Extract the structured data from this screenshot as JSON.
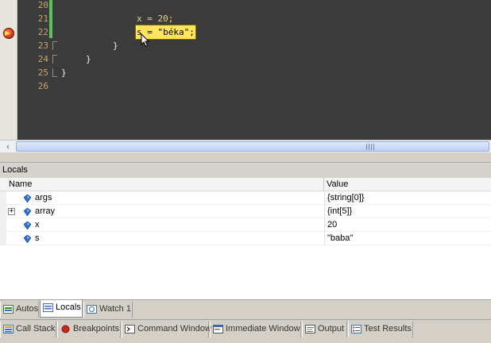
{
  "editor": {
    "lines": [
      {
        "num": "20",
        "code": ""
      },
      {
        "num": "21",
        "code": "x = 20;"
      },
      {
        "num": "22",
        "code": "s = \"béka\";"
      },
      {
        "num": "23",
        "code": "}"
      },
      {
        "num": "24",
        "code": "}"
      },
      {
        "num": "25",
        "code": "}"
      },
      {
        "num": "26",
        "code": ""
      }
    ],
    "current_line": "22",
    "breakpoint_icon": "breakpoint-arrow-icon"
  },
  "locals": {
    "title": "Locals",
    "columns": {
      "name": "Name",
      "value": "Value"
    },
    "rows": [
      {
        "name": "args",
        "value": "{string[0]}",
        "expandable": false
      },
      {
        "name": "array",
        "value": "{int[5]}",
        "expandable": true
      },
      {
        "name": "x",
        "value": "20",
        "expandable": false
      },
      {
        "name": "s",
        "value": "\"baba\"",
        "expandable": false
      }
    ]
  },
  "tabs_top": [
    {
      "label": "Autos",
      "icon": "autos-icon",
      "active": false
    },
    {
      "label": "Locals",
      "icon": "locals-icon",
      "active": true
    },
    {
      "label": "Watch 1",
      "icon": "watch-icon",
      "active": false
    }
  ],
  "tabs_bottom": [
    {
      "label": "Call Stack",
      "icon": "call-stack-icon"
    },
    {
      "label": "Breakpoints",
      "icon": "breakpoints-icon"
    },
    {
      "label": "Command Window",
      "icon": "command-window-icon"
    },
    {
      "label": "Immediate Window",
      "icon": "immediate-window-icon"
    },
    {
      "label": "Output",
      "icon": "output-icon"
    },
    {
      "label": "Test Results",
      "icon": "test-results-icon"
    }
  ],
  "colors": {
    "editor_bg": "#3b3b3b",
    "highlight": "#ffe45c",
    "line_numbers": "#c7a86c",
    "change_bar": "#5dc05d"
  }
}
